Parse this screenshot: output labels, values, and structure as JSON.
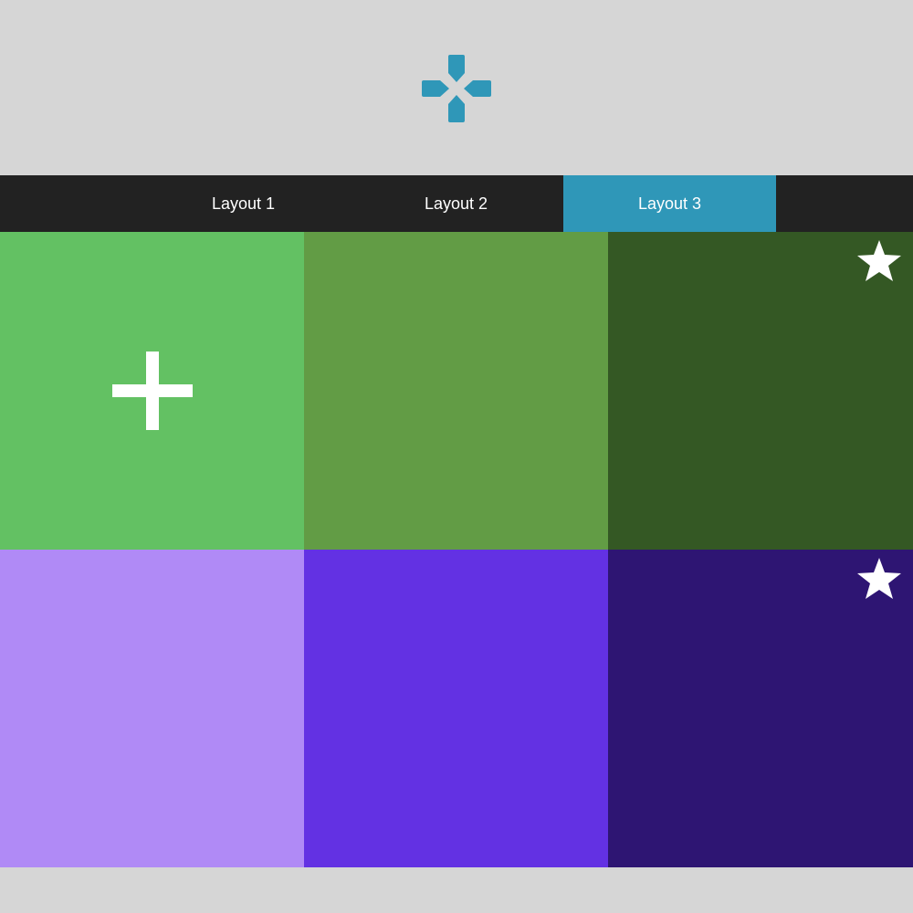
{
  "header": {
    "logo_icon": "gamepad-dpad-icon",
    "logo_color": "#2f97b8"
  },
  "nav": {
    "tabs": [
      {
        "label": "Layout 1",
        "active": false
      },
      {
        "label": "Layout 2",
        "active": false
      },
      {
        "label": "Layout 3",
        "active": true
      }
    ],
    "background": "#222222",
    "active_color": "#2f97b8"
  },
  "tiles": [
    {
      "color": "#63c163",
      "icon": "plus-icon"
    },
    {
      "color": "#629c45",
      "icon": ""
    },
    {
      "color": "#345824",
      "icon": "star-icon"
    },
    {
      "color": "#b08af6",
      "icon": ""
    },
    {
      "color": "#6331e3",
      "icon": ""
    },
    {
      "color": "#2e1573",
      "icon": "star-icon"
    }
  ]
}
